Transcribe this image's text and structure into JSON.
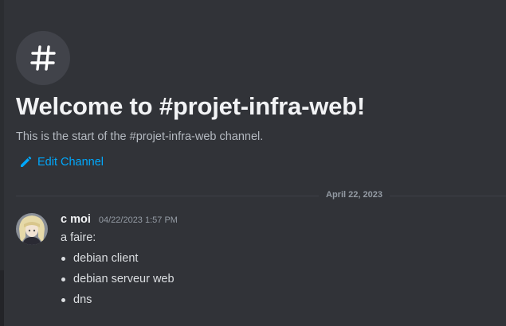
{
  "channel": {
    "welcome_title": "Welcome to #projet-infra-web!",
    "welcome_subtitle": "This is the start of the #projet-infra-web channel.",
    "edit_label": "Edit Channel",
    "icon": "hash-icon"
  },
  "divider": {
    "date": "April 22, 2023"
  },
  "message": {
    "author": "c moi",
    "timestamp": "04/22/2023 1:57 PM",
    "text": "a faire:",
    "list_items": [
      "debian client",
      "debian serveur web",
      "dns"
    ]
  },
  "colors": {
    "background": "#313338",
    "link": "#00a8fc",
    "header": "#f2f3f5",
    "muted": "#949ba4"
  }
}
